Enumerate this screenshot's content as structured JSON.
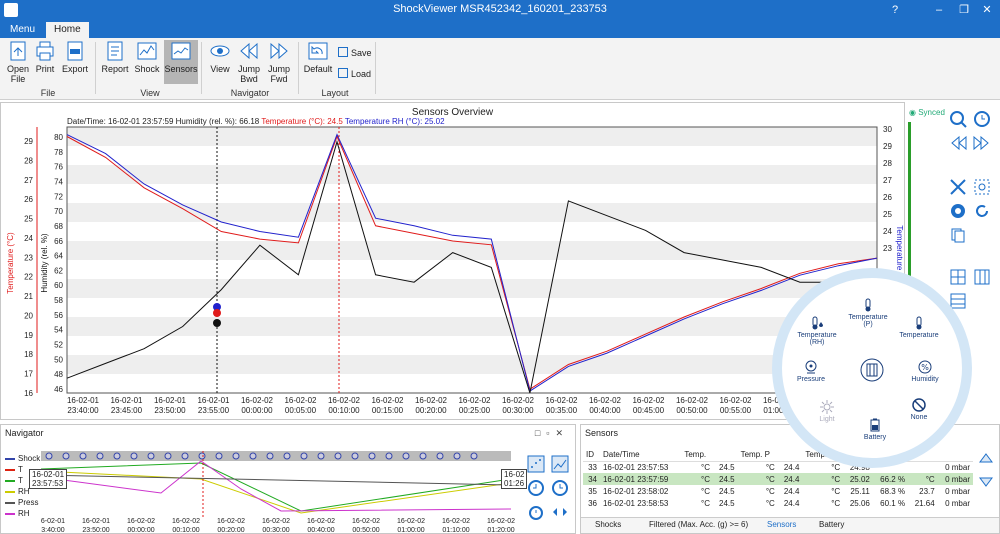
{
  "window": {
    "title": "ShockViewer MSR452342_160201_233753",
    "help": "?",
    "minimize": "–",
    "restore": "❐",
    "close": "✕"
  },
  "tabs": [
    {
      "label": "Menu"
    },
    {
      "label": "Home"
    }
  ],
  "ribbon": {
    "open_file": "Open\nFile",
    "print": "Print",
    "export": "Export",
    "file_group": "File",
    "report": "Report",
    "shock": "Shock",
    "sensors": "Sensors",
    "view_group": "View",
    "view": "View",
    "jump_bwd": "Jump\nBwd",
    "jump_fwd": "Jump\nFwd",
    "navigator_group": "Navigator",
    "default": "Default",
    "save": "Save",
    "load": "Load",
    "layout_group": "Layout"
  },
  "chart": {
    "title": "Sensors Overview",
    "readout_prefix": "Date/Time: 16-02-01 23:57:59  Humidity (rel. %): 66.18",
    "readout_temp": "Temperature (°C): 24.5",
    "readout_temprh": "Temperature RH (°C): 25.02",
    "synced": "Synced",
    "ylabel_left_temp": "Temperature (°C)",
    "ylabel_left_hum": "Humidity (rel. %)",
    "ylabel_right": "Temperature RH (°C)",
    "colors": {
      "temp": "#e01b1b",
      "temprh": "#2222cc",
      "hum": "#111111",
      "grid": "#e6e6e6"
    }
  },
  "chart_data": {
    "type": "line",
    "x_ticks": [
      "16-02-01\n23:40:00",
      "16-02-01\n23:45:00",
      "16-02-01\n23:50:00",
      "16-02-01\n23:55:00",
      "16-02-02\n00:00:00",
      "16-02-02\n00:05:00",
      "16-02-02\n00:10:00",
      "16-02-02\n00:15:00",
      "16-02-02\n00:20:00",
      "16-02-02\n00:25:00",
      "16-02-02\n00:30:00",
      "16-02-02\n00:35:00",
      "16-02-02\n00:40:00",
      "16-02-02\n00:45:00",
      "16-02-02\n00:50:00",
      "16-02-02\n00:55:00",
      "16-02-02\n01:00:00",
      "16-02-02\n01:05:00",
      "16-02-02\n01:10:00",
      "16-02-02\n01:15:00"
    ],
    "y_left_temp_ticks": [
      "29",
      "28",
      "27",
      "26",
      "25",
      "24",
      "23",
      "22",
      "21",
      "20",
      "19",
      "18",
      "17",
      "16"
    ],
    "y_left_hum_ticks": [
      "80",
      "78",
      "76",
      "74",
      "72",
      "70",
      "68",
      "66",
      "64",
      "62",
      "60",
      "58",
      "56",
      "54",
      "52",
      "50",
      "48",
      "46"
    ],
    "y_right_ticks": [
      "30",
      "29",
      "28",
      "27",
      "26",
      "25",
      "24",
      "23"
    ],
    "series": [
      {
        "name": "Temperature (°C)",
        "color": "#e01b1b",
        "values": [
          29.5,
          28.4,
          26.8,
          25.7,
          24.5,
          24.1,
          23.9,
          29.5,
          24.8,
          24.4,
          24.0,
          23.8,
          16.2,
          17.5,
          18.2,
          19.1,
          20.0,
          20.8,
          21.5,
          22.3,
          22.8,
          23.1
        ]
      },
      {
        "name": "Temperature RH (°C)",
        "color": "#2222cc",
        "values": [
          29.6,
          28.6,
          27.0,
          25.9,
          25.0,
          24.5,
          24.2,
          29.6,
          25.2,
          24.8,
          24.3,
          24.1,
          16.1,
          17.4,
          18.1,
          19.0,
          19.9,
          20.7,
          21.4,
          22.2,
          22.7,
          23.1
        ]
      },
      {
        "name": "Humidity (rel. %)",
        "color": "#111111",
        "values": [
          48,
          50,
          52,
          55,
          60,
          66,
          62,
          80,
          62,
          61,
          65,
          63,
          46,
          72,
          70,
          68,
          65,
          64,
          63,
          61,
          61,
          62
        ]
      }
    ]
  },
  "navigator": {
    "title": "Navigator",
    "legend": [
      {
        "label": "Shock",
        "color": "#3344aa"
      },
      {
        "label": "T",
        "color": "#d21"
      },
      {
        "label": "T",
        "color": "#2a2"
      },
      {
        "label": "RH",
        "color": "#cc0"
      },
      {
        "label": "Press",
        "color": "#555"
      },
      {
        "label": "RH",
        "color": "#c3c"
      }
    ],
    "tooltip_left": "16-02-01\n23:57:53",
    "tooltip_right": "16-02\n01:26",
    "x_ticks": [
      "16-02-01\n23:40:00",
      "16-02-01\n23:50:00",
      "16-02-02\n00:00:00",
      "16-02-02\n00:10:00",
      "16-02-02\n00:20:00",
      "16-02-02\n00:30:00",
      "16-02-02\n00:40:00",
      "16-02-02\n00:50:00",
      "16-02-02\n01:00:00",
      "16-02-02\n01:10:00",
      "16-02-02\n01:20:00"
    ]
  },
  "sensors": {
    "title": "Sensors",
    "columns": [
      "ID",
      "Date/Time",
      "Temp.",
      "",
      "Temp. P",
      "",
      "Temp. R"
    ],
    "rows": [
      {
        "id": "33",
        "dt": "16-02-01 23:57:53",
        "u1": "°C",
        "t": "24.5",
        "u2": "°C",
        "tp": "24.4",
        "u3": "°C",
        "tr": "24.98",
        "hum": "",
        "u4": "",
        "p": "0",
        "pu": "mbar"
      },
      {
        "id": "34",
        "dt": "16-02-01 23:57:59",
        "u1": "°C",
        "t": "24.5",
        "u2": "°C",
        "tp": "24.4",
        "u3": "°C",
        "tr": "25.02",
        "hum": "66.2 %",
        "u4": "°C",
        "p": "0",
        "pu": "mbar"
      },
      {
        "id": "35",
        "dt": "16-02-01 23:58:02",
        "u1": "°C",
        "t": "24.5",
        "u2": "°C",
        "tp": "24.4",
        "u3": "°C",
        "tr": "25.11",
        "hum": "68.3 %",
        "u4": "23.7",
        "p": "0",
        "pu": "mbar"
      },
      {
        "id": "36",
        "dt": "16-02-01 23:58:53",
        "u1": "°C",
        "t": "24.5",
        "u2": "°C",
        "tp": "24.4",
        "u3": "°C",
        "tr": "25.06",
        "hum": "60.1 %",
        "u4": "21.64",
        "p": "0",
        "pu": "mbar"
      }
    ],
    "bottom_tabs": [
      "Shocks",
      "Filtered (Max. Acc. (g) >= 6)",
      "Sensors",
      "Battery"
    ]
  },
  "radial_menu": {
    "temp_p": "Temperature\n(P)",
    "temp_rh": "Temperature\n(RH)",
    "temperature": "Temperature",
    "pressure": "Pressure",
    "humidity": "Humidity",
    "light": "Light",
    "none": "None",
    "battery": "Battery"
  }
}
